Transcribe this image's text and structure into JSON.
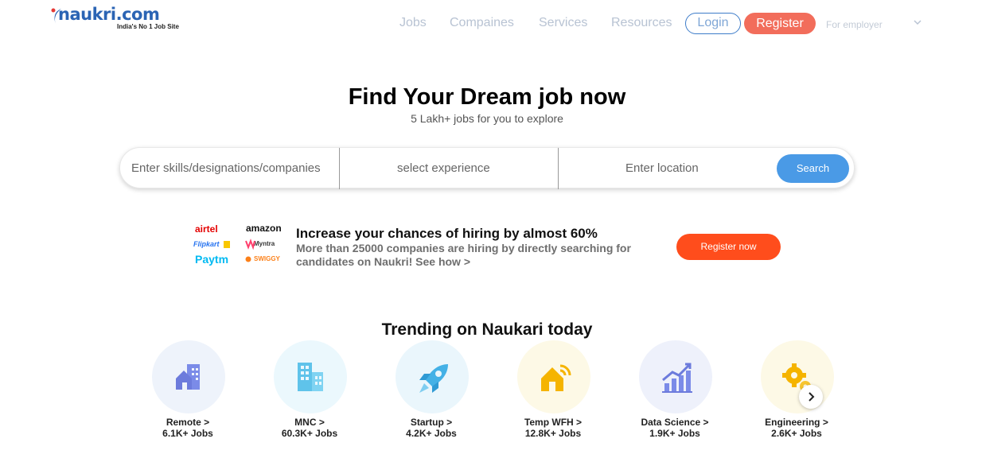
{
  "header": {
    "logo": {
      "text": "naukri.com",
      "tagline": "India's No 1 Job Site"
    },
    "nav": [
      "Jobs",
      "Compaines",
      "Services",
      "Resources"
    ],
    "login_label": "Login",
    "register_label": "Register",
    "employer_label": "For employer"
  },
  "hero": {
    "title": "Find Your Dream job now",
    "subtitle": "5 Lakh+ jobs for you to explore"
  },
  "search": {
    "skills_placeholder": "Enter skills/designations/companies",
    "experience_placeholder": "select experience",
    "location_placeholder": "Enter location",
    "button_label": "Search"
  },
  "promo": {
    "brands": [
      "airtel",
      "amazon",
      "Flipkart",
      "Myntra",
      "Paytm",
      "SWIGGY"
    ],
    "title": "Increase your chances of hiring by almost 60%",
    "desc_line1": "More than 25000 companies are hiring by directly searching for",
    "desc_line2": "candidates on Naukri! See how >",
    "button_label": "Register now"
  },
  "trending": {
    "title": "Trending on Naukari today",
    "items": [
      {
        "label": "Remote >",
        "count": "6.1K+ Jobs",
        "icon": "building-icon"
      },
      {
        "label": "MNC >",
        "count": "60.3K+ Jobs",
        "icon": "office-tower-icon"
      },
      {
        "label": "Startup >",
        "count": "4.2K+ Jobs",
        "icon": "rocket-icon"
      },
      {
        "label": "Temp WFH >",
        "count": "12.8K+ Jobs",
        "icon": "home-wifi-icon"
      },
      {
        "label": "Data Science >",
        "count": "1.9K+ Jobs",
        "icon": "growth-chart-icon"
      },
      {
        "label": "Engineering >",
        "count": "2.6K+ Jobs",
        "icon": "gears-icon"
      }
    ]
  },
  "colors": {
    "brand_blue": "#2b64b4",
    "register_red": "#f26d5b",
    "search_blue": "#4a9ae6",
    "promo_orange": "#ff4d1c"
  }
}
